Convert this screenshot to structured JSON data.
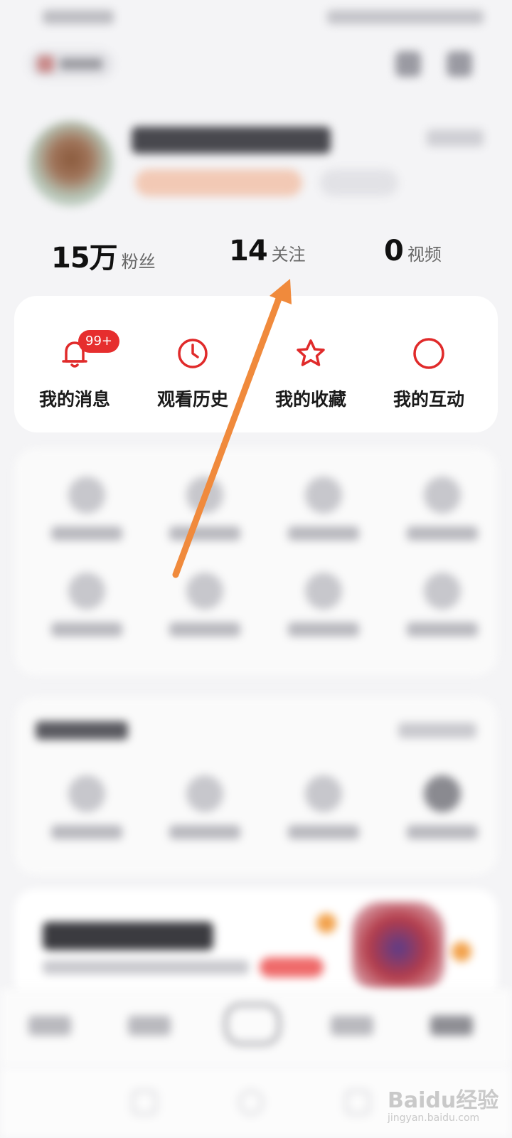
{
  "stats": [
    {
      "value": "15万",
      "label": "粉丝"
    },
    {
      "value": "14",
      "label": "关注"
    },
    {
      "value": "0",
      "label": "视频"
    }
  ],
  "quick_actions": [
    {
      "label": "我的消息",
      "icon": "bell-icon",
      "badge": "99+"
    },
    {
      "label": "观看历史",
      "icon": "clock-icon"
    },
    {
      "label": "我的收藏",
      "icon": "star-icon"
    },
    {
      "label": "我的互动",
      "icon": "circle-icon"
    }
  ],
  "colors": {
    "accent": "#e02a2a",
    "badge": "#e62e2e",
    "arrow": "#f08a3c"
  },
  "watermark": {
    "logo": "Baidu经验",
    "url": "jingyan.baidu.com"
  }
}
